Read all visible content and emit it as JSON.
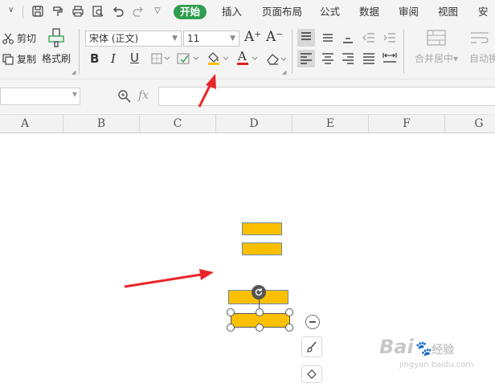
{
  "menubar": {
    "tabs": [
      {
        "label": "开始",
        "active": true
      },
      {
        "label": "插入"
      },
      {
        "label": "页面布局"
      },
      {
        "label": "公式"
      },
      {
        "label": "数据"
      },
      {
        "label": "审阅"
      },
      {
        "label": "视图"
      },
      {
        "label": "安"
      }
    ],
    "quick_icons": [
      "save-icon",
      "format-paint-icon",
      "print-icon",
      "print-preview-icon",
      "undo-icon",
      "redo-icon",
      "customize-dropdown-icon"
    ]
  },
  "ribbon": {
    "cut_label": "剪切",
    "copy_label": "复制",
    "format_painter_label": "格式刷",
    "font_name": "宋体 (正文)",
    "font_size": "11",
    "increase_font_glyph": "A⁺",
    "decrease_font_glyph": "A⁻",
    "bold": "B",
    "italic": "I",
    "underline": "U",
    "font_color_letter": "A",
    "merge_label": "合并居中",
    "autowrap_label": "自动换",
    "fill_color": "#fcc000",
    "font_color": "#e02020"
  },
  "formulabar": {
    "fx_label": "fx",
    "name_box_value": "",
    "formula_value": ""
  },
  "columns": [
    "A",
    "B",
    "C",
    "D",
    "E",
    "F",
    "G"
  ],
  "canvas": {
    "shape_fill": "#fcc000",
    "arrow_color": "#e8262a"
  },
  "watermark": {
    "brand": "Bai",
    "brand2": "经验",
    "url": "jingyan.baidu.com"
  }
}
